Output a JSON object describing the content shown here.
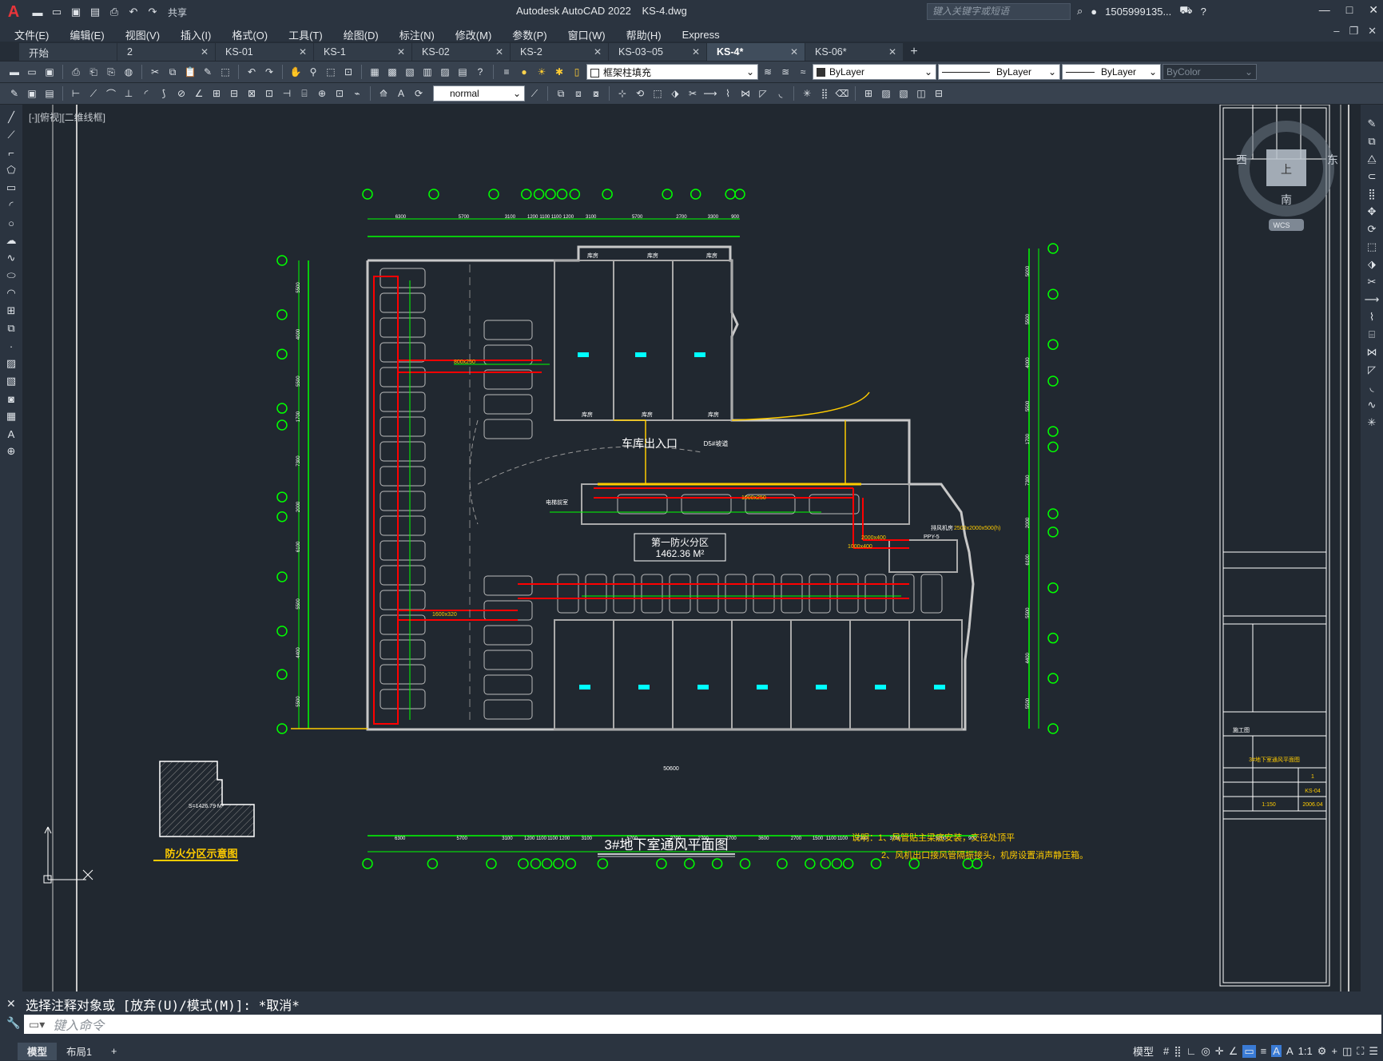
{
  "app": {
    "title": "Autodesk AutoCAD 2022",
    "filename": "KS-4.dwg",
    "share": "共享"
  },
  "search": {
    "placeholder": "键入关键字或短语"
  },
  "user": {
    "name": "1505999135..."
  },
  "menus": [
    "文件(E)",
    "编辑(E)",
    "视图(V)",
    "插入(I)",
    "格式(O)",
    "工具(T)",
    "绘图(D)",
    "标注(N)",
    "修改(M)",
    "参数(P)",
    "窗口(W)",
    "帮助(H)",
    "Express"
  ],
  "tabs": [
    {
      "label": "开始",
      "closable": false,
      "active": false
    },
    {
      "label": "2",
      "closable": true,
      "active": false
    },
    {
      "label": "KS-01",
      "closable": true,
      "active": false
    },
    {
      "label": "KS-1",
      "closable": true,
      "active": false
    },
    {
      "label": "KS-02",
      "closable": true,
      "active": false
    },
    {
      "label": "KS-2",
      "closable": true,
      "active": false
    },
    {
      "label": "KS-03~05",
      "closable": true,
      "active": false
    },
    {
      "label": "KS-4*",
      "closable": true,
      "active": true
    },
    {
      "label": "KS-06*",
      "closable": true,
      "active": false
    }
  ],
  "toolbar": {
    "layer": "框架柱填充",
    "color": "ByLayer",
    "linetype": "ByLayer",
    "lineweight": "ByLayer",
    "plotstyle": "ByColor",
    "textstyle": "normal"
  },
  "viewport": {
    "label": "[-][俯视][二维线框]"
  },
  "viewcube": {
    "top": "上",
    "south": "南",
    "east": "东",
    "west": "西",
    "wcs": "WCS"
  },
  "drawing": {
    "entrance": "车库出入口",
    "ramp": "D5#坡道",
    "zone_title": "第一防火分区",
    "zone_area": "1462.36 M²",
    "main_title": "3#地下室通风平面图",
    "legend_title": "防火分区示意图",
    "legend_area": "S=1426.79 M²",
    "note1": "说明：1、风管贴主梁底安装，交径处顶平",
    "note2": "2、风机出口接风管隔振接头，机房设置消声静压箱。",
    "machine_room": "排风机房",
    "ppf_label": "PPY-5",
    "ppf_size": "2500x2000x500(h)",
    "duct_size1": "800x250",
    "duct_size2": "1000x250",
    "duct_size3": "1600x320",
    "duct_size4": "2000x400",
    "duct_size5": "1000x400",
    "room_label": "库房",
    "shaft_label": "电梯前室",
    "bottom_total": "50600",
    "top_dims": [
      "6300",
      "5700",
      "3100",
      "1200",
      "1100",
      "1100",
      "1200",
      "3100",
      "5700",
      "2700",
      "3300",
      "900"
    ],
    "bottom_dims": [
      "6300",
      "5700",
      "3100",
      "1200",
      "1100",
      "1100",
      "1200",
      "3100",
      "5700",
      "2700",
      "2700",
      "2700",
      "3600",
      "2700",
      "1500",
      "1100",
      "1100",
      "2700",
      "3700",
      "5200",
      "900"
    ],
    "left_dims": [
      "5500",
      "4000",
      "5500",
      "1700",
      "7300",
      "2000",
      "6100",
      "5500",
      "4400",
      "5500"
    ],
    "right_dims": [
      "5000",
      "5500",
      "4000",
      "5500",
      "1700",
      "7300",
      "2000",
      "6100",
      "5500",
      "4400",
      "5500"
    ],
    "title_block": {
      "project": "3#地下室通风平面图",
      "drawing_no": "KS-04",
      "scale": "1:150",
      "date": "2006.04",
      "stage": "施工图",
      "page": "1"
    }
  },
  "command": {
    "history": "选择注释对象或 [放弃(U)/模式(M)]: *取消*",
    "placeholder": "键入命令"
  },
  "layout_tabs": [
    {
      "label": "模型",
      "active": true
    },
    {
      "label": "布局1",
      "active": false
    }
  ],
  "status": {
    "model": "模型",
    "scale": "1:1"
  },
  "colors": {
    "canvas": "#212830",
    "green": "#00ff00",
    "red": "#ff0000",
    "yellow": "#ffcc00",
    "wall": "#c8c8c8",
    "cyan": "#00ffff"
  }
}
